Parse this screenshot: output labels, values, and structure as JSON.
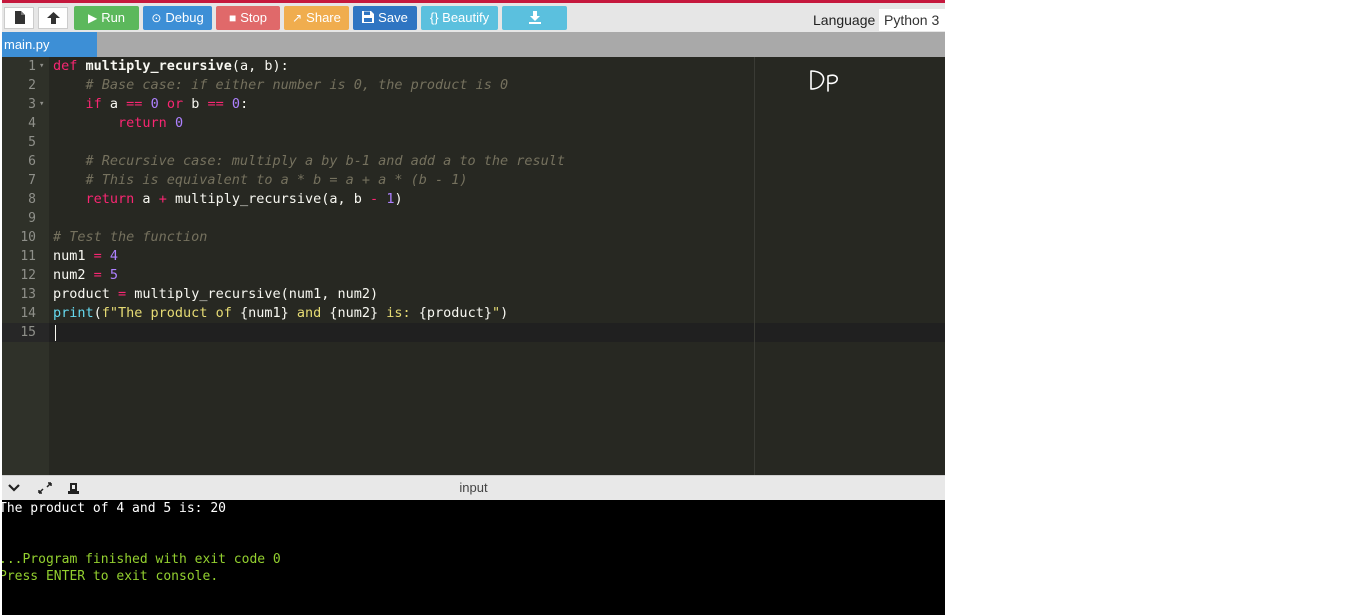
{
  "colors": {
    "accent": "#c5183d",
    "run": "#5cb85c",
    "debug": "#3d8fd6",
    "stop": "#e0696a",
    "share": "#f0ad4e",
    "save": "#2f75c2",
    "beautify": "#5bc0de",
    "download": "#5bc0de",
    "console_output": "#ffffff",
    "console_status": "#93d02f"
  },
  "toolbar": {
    "new_file_icon": "file-icon",
    "upload_icon": "upload-icon",
    "run_label": "Run",
    "debug_label": "Debug",
    "stop_label": "Stop",
    "share_label": "Share",
    "save_label": "Save",
    "beautify_label": "{} Beautify",
    "download_icon": "download-icon",
    "language_label": "Language",
    "language_value": "Python 3"
  },
  "tab": {
    "label": "main.py"
  },
  "editor": {
    "line_numbers": [
      "1",
      "2",
      "3",
      "4",
      "5",
      "6",
      "7",
      "8",
      "9",
      "10",
      "11",
      "12",
      "13",
      "14",
      "15"
    ],
    "annotation_text": "DP"
  },
  "console_bar": {
    "title": "input"
  },
  "console": {
    "output": "The product of 4 and 5 is: 20",
    "finished": "...Program finished with exit code 0",
    "press_enter": "Press ENTER to exit console."
  }
}
